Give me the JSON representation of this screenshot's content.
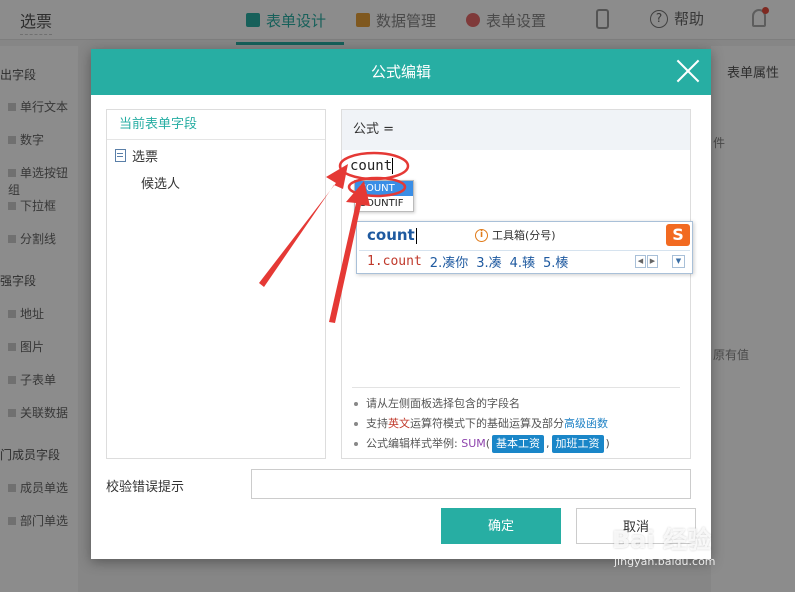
{
  "app": {
    "title": "选票",
    "nav": {
      "design": "表单设计",
      "data": "数据管理",
      "settings": "表单设置"
    },
    "help": "帮助"
  },
  "left_panel": {
    "sections": [
      "出字段",
      "强字段",
      "门成员字段"
    ],
    "items": [
      "单行文本",
      "数字",
      "单选按钮组",
      "下拉框",
      "分割线",
      "地址",
      "图片",
      "子表单",
      "关联数据",
      "成员单选",
      "部门单选"
    ]
  },
  "right_panel": {
    "tab": "表单属性",
    "text1": "件",
    "text2": "原有值"
  },
  "dialog": {
    "title": "公式编辑",
    "fields_panel": {
      "title": "当前表单字段",
      "form_name": "选票",
      "field": "候选人"
    },
    "formula": {
      "label": "公式 =",
      "input_value": "count",
      "autocomplete": [
        "COUNT",
        "COUNTIF"
      ]
    },
    "ime": {
      "input": "count",
      "toolbox": "工具箱(分号)",
      "logo": "S",
      "candidates": [
        "1.count",
        "2.凑你",
        "3.凑",
        "4.辏",
        "5.楱"
      ]
    },
    "hints": {
      "hint1": "请从左侧面板选择包含的字段名",
      "hint2_a": "支持",
      "hint2_b": "英文",
      "hint2_c": "运算符模式下的基础运算及部分",
      "hint2_d": "高级函数",
      "hint3_a": "公式编辑样式举例:",
      "hint3_b": "SUM",
      "hint3_c": "(",
      "hint3_tag1": "基本工资",
      "hint3_d": ",",
      "hint3_tag2": "加班工资",
      "hint3_e": ")"
    },
    "error_label": "校验错误提示",
    "ok": "确定",
    "cancel": "取消"
  },
  "watermark": {
    "main": "Bai 经验",
    "url": "jingyan.baidu.com"
  },
  "colors": {
    "accent": "#27aea3",
    "annotation": "#e53935",
    "tag": "#1a86c8"
  }
}
